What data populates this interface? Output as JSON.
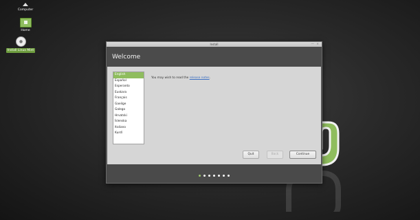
{
  "desktop": {
    "icons": [
      {
        "label": "Computer"
      },
      {
        "label": "Home"
      },
      {
        "label": "Install Linux Mint"
      }
    ]
  },
  "window": {
    "title": "Install",
    "minimize_glyph": "—",
    "close_glyph": "×",
    "header": "Welcome",
    "languages": [
      "English",
      "Español",
      "Esperanto",
      "Euskara",
      "Français",
      "Gaeilge",
      "Galego",
      "Hrvatski",
      "Íslenska",
      "Italiano",
      "Kurdî"
    ],
    "selected_language": "English",
    "release_text_prefix": "You may wish to read the ",
    "release_link": "release notes",
    "release_text_suffix": ".",
    "buttons": {
      "quit": "Quit",
      "back": "Back",
      "continue": "Continue"
    },
    "progress_steps": 7,
    "current_step": 1
  },
  "colors": {
    "accent": "#8fbd5e"
  }
}
